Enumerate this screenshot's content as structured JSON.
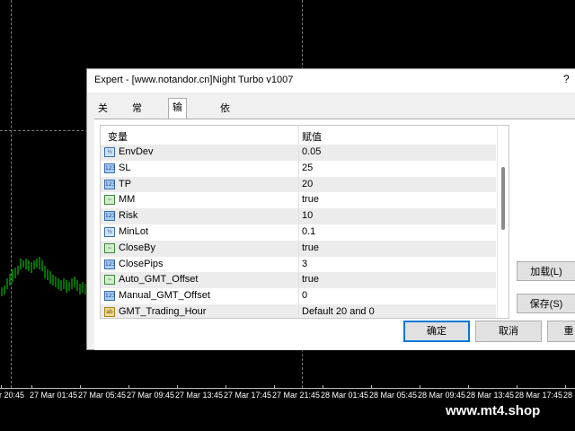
{
  "dialog": {
    "title": "Expert - [www.notandor.cn]Night Turbo v1007",
    "help": "?",
    "tabs": [
      {
        "label": "关于"
      },
      {
        "label": "常用"
      },
      {
        "label": "输入参数"
      },
      {
        "label": "依存关系"
      }
    ],
    "active_tab": "输入参数",
    "table": {
      "headers": {
        "variable": "变量",
        "value": "赋值"
      },
      "rows": [
        {
          "icon": "double-type-icon",
          "icon_glyph": "½",
          "name": "EnvDev",
          "value": "0.05"
        },
        {
          "icon": "int-type-icon",
          "icon_glyph": "123",
          "name": "SL",
          "value": "25"
        },
        {
          "icon": "int-type-icon",
          "icon_glyph": "123",
          "name": "TP",
          "value": "20"
        },
        {
          "icon": "bool-type-icon",
          "icon_glyph": "~",
          "name": "MM",
          "value": "true"
        },
        {
          "icon": "int-type-icon",
          "icon_glyph": "123",
          "name": "Risk",
          "value": "10"
        },
        {
          "icon": "double-type-icon",
          "icon_glyph": "½",
          "name": "MinLot",
          "value": "0.1"
        },
        {
          "icon": "bool-type-icon",
          "icon_glyph": "~",
          "name": "CloseBy",
          "value": "true"
        },
        {
          "icon": "int-type-icon",
          "icon_glyph": "123",
          "name": "ClosePips",
          "value": "3"
        },
        {
          "icon": "bool-type-icon",
          "icon_glyph": "~",
          "name": "Auto_GMT_Offset",
          "value": "true"
        },
        {
          "icon": "int-type-icon",
          "icon_glyph": "123",
          "name": "Manual_GMT_Offset",
          "value": "0"
        },
        {
          "icon": "string-type-icon",
          "icon_glyph": "ab",
          "name": "GMT_Trading_Hour",
          "value": "Default 20 and 0"
        }
      ]
    },
    "buttons": {
      "load": "加载(L)",
      "save": "保存(S)",
      "ok": "确定",
      "cancel": "取消",
      "reset": "重"
    }
  },
  "chart": {
    "time_labels": [
      "r 20:45",
      "27 Mar 01:45",
      "27 Mar 05:45",
      "27 Mar 09:45",
      "27 Mar 13:45",
      "27 Mar 17:45",
      "27 Mar 21:45",
      "28 Mar 01:45",
      "28 Mar 05:45",
      "28 Mar 09:45",
      "28 Mar 13:45",
      "28 Mar 17:45",
      "28 Mar"
    ]
  },
  "watermark": "www.mt4.shop"
}
